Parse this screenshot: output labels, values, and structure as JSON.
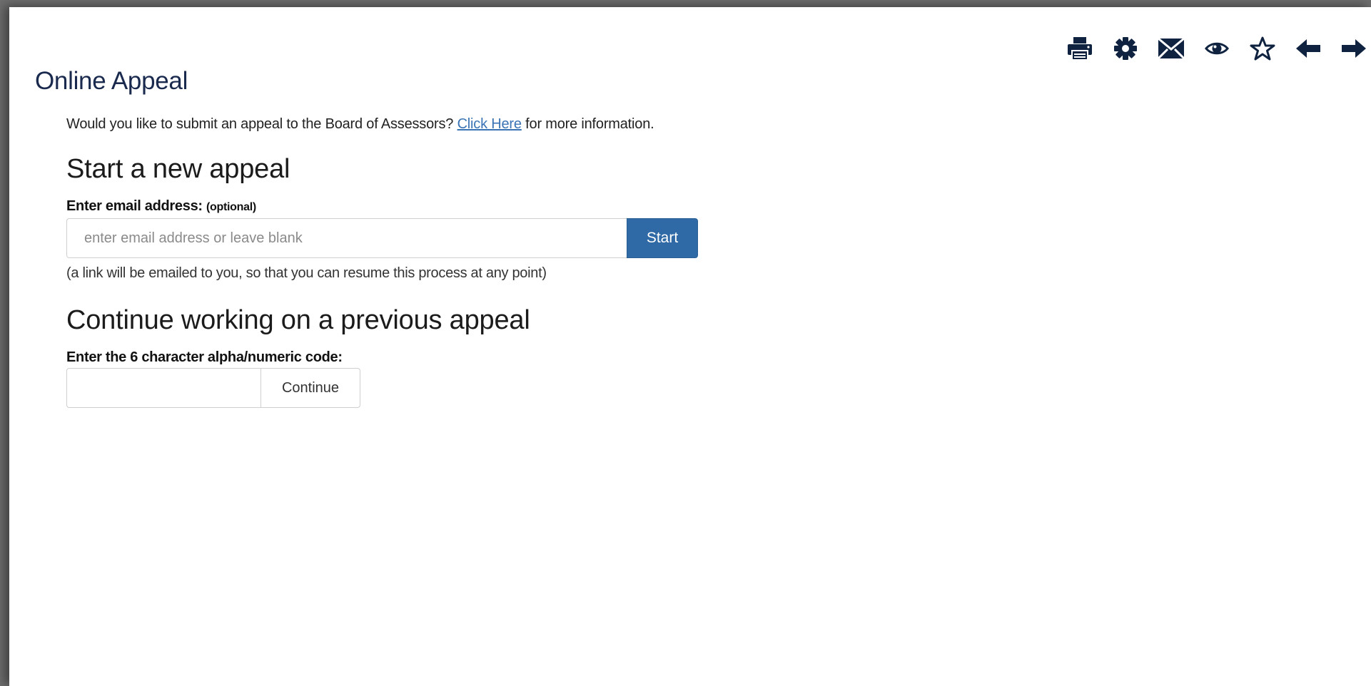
{
  "toolbar": {
    "icons": [
      "printer-icon",
      "gear-icon",
      "mail-icon",
      "eye-icon",
      "star-icon",
      "arrow-left-icon",
      "arrow-right-icon"
    ],
    "icon_color": "#0f2340"
  },
  "page": {
    "title": "Online Appeal",
    "intro_prefix": "Would you like to submit an appeal to the Board of Assessors?",
    "intro_link": "Click Here",
    "intro_suffix": "for more information."
  },
  "new_appeal": {
    "heading": "Start a new appeal",
    "email_label": "Enter email address:",
    "email_optional": "(optional)",
    "email_placeholder": "enter email address or leave blank",
    "email_value": "",
    "start_label": "Start",
    "note": "(a link will be emailed to you, so that you can resume this process at any point)"
  },
  "continue_appeal": {
    "heading": "Continue working on a previous appeal",
    "code_label": "Enter the 6 character alpha/numeric code:",
    "code_value": "",
    "continue_label": "Continue"
  },
  "colors": {
    "accent": "#2f6aa6",
    "link": "#3b74b5",
    "title": "#1a2a4e"
  }
}
